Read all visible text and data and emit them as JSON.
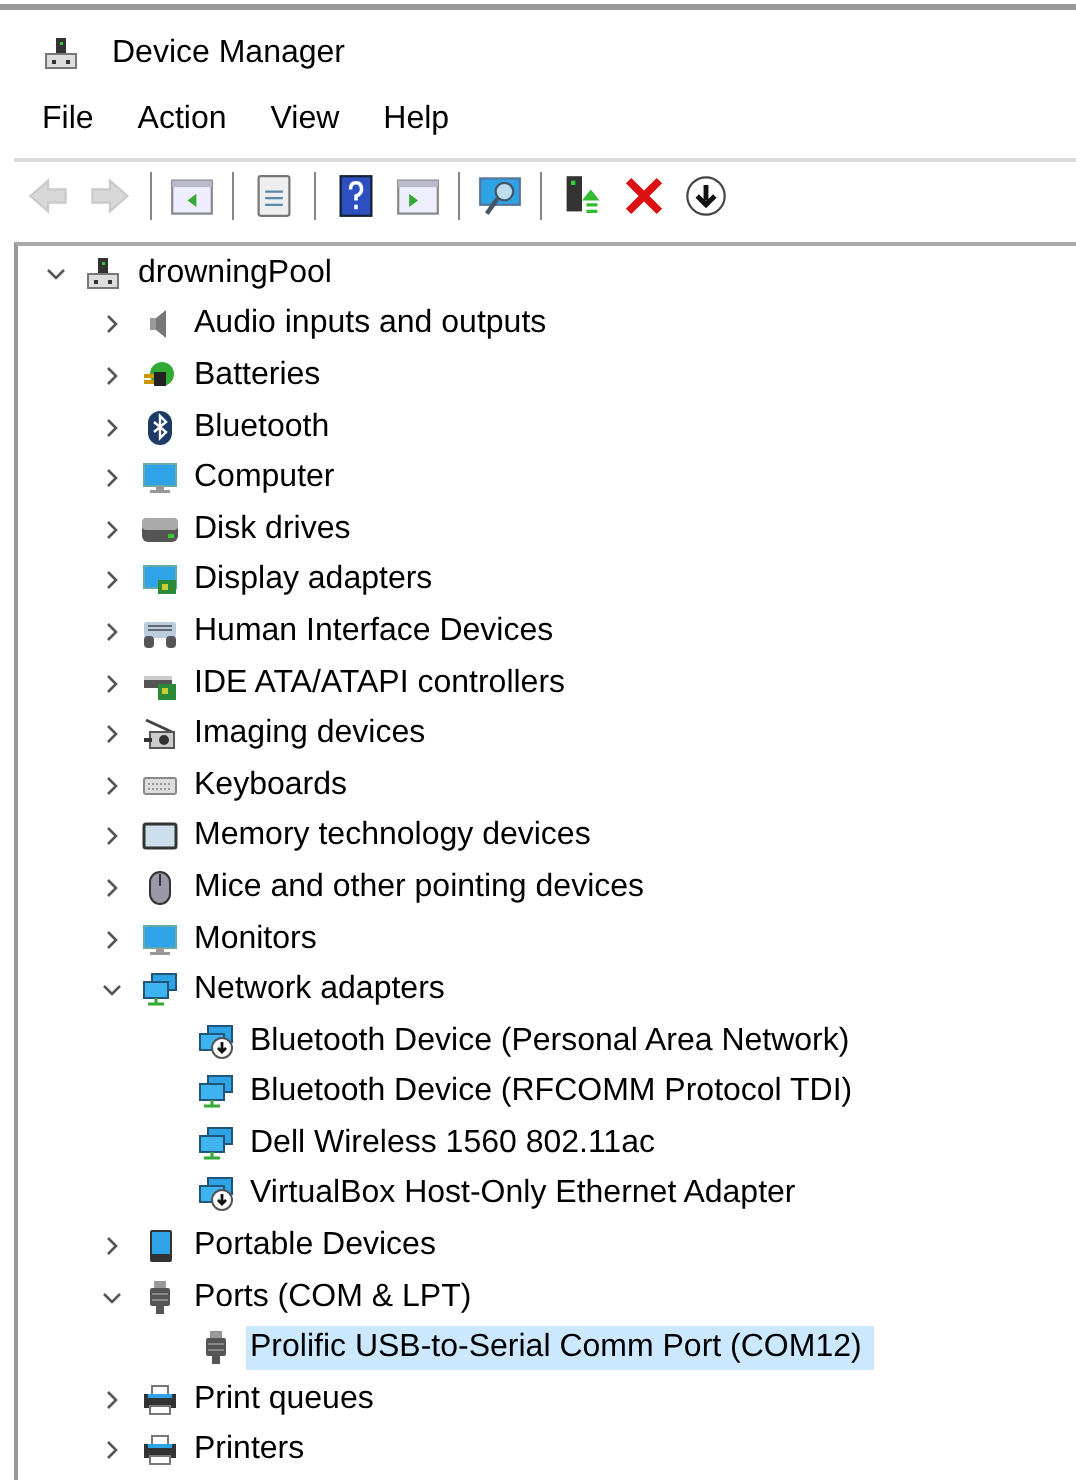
{
  "window": {
    "title": "Device Manager"
  },
  "menu": [
    "File",
    "Action",
    "View",
    "Help"
  ],
  "toolbar": [
    {
      "kind": "back",
      "disabled": true
    },
    {
      "kind": "forward",
      "disabled": true
    },
    {
      "kind": "separator"
    },
    {
      "kind": "pane",
      "disabled": false
    },
    {
      "kind": "separator"
    },
    {
      "kind": "properties",
      "disabled": false
    },
    {
      "kind": "separator"
    },
    {
      "kind": "help",
      "disabled": false
    },
    {
      "kind": "pane2",
      "disabled": false
    },
    {
      "kind": "separator"
    },
    {
      "kind": "scan",
      "disabled": false
    },
    {
      "kind": "separator"
    },
    {
      "kind": "update",
      "disabled": false
    },
    {
      "kind": "uninstall",
      "disabled": false
    },
    {
      "kind": "disable",
      "disabled": false
    }
  ],
  "tree": {
    "label": "drowningPool",
    "kind": "computer-node",
    "expanded": true,
    "selected": false,
    "children": [
      {
        "label": "Audio inputs and outputs",
        "kind": "speaker",
        "expanded": false,
        "selected": false
      },
      {
        "label": "Batteries",
        "kind": "battery",
        "expanded": false,
        "selected": false
      },
      {
        "label": "Bluetooth",
        "kind": "bluetooth",
        "expanded": false,
        "selected": false
      },
      {
        "label": "Computer",
        "kind": "monitor",
        "expanded": false,
        "selected": false
      },
      {
        "label": "Disk drives",
        "kind": "disk",
        "expanded": false,
        "selected": false
      },
      {
        "label": "Display adapters",
        "kind": "display-adapter",
        "expanded": false,
        "selected": false
      },
      {
        "label": "Human Interface Devices",
        "kind": "hid",
        "expanded": false,
        "selected": false
      },
      {
        "label": "IDE ATA/ATAPI controllers",
        "kind": "ide",
        "expanded": false,
        "selected": false
      },
      {
        "label": "Imaging devices",
        "kind": "camera",
        "expanded": false,
        "selected": false
      },
      {
        "label": "Keyboards",
        "kind": "keyboard",
        "expanded": false,
        "selected": false
      },
      {
        "label": "Memory technology devices",
        "kind": "memory",
        "expanded": false,
        "selected": false
      },
      {
        "label": "Mice and other pointing devices",
        "kind": "mouse",
        "expanded": false,
        "selected": false
      },
      {
        "label": "Monitors",
        "kind": "monitor",
        "expanded": false,
        "selected": false
      },
      {
        "label": "Network adapters",
        "kind": "network",
        "expanded": true,
        "selected": false,
        "children": [
          {
            "label": "Bluetooth Device (Personal Area Network)",
            "kind": "network-disabled",
            "selected": false
          },
          {
            "label": "Bluetooth Device (RFCOMM Protocol TDI)",
            "kind": "network",
            "selected": false
          },
          {
            "label": "Dell Wireless 1560 802.11ac",
            "kind": "network",
            "selected": false
          },
          {
            "label": "VirtualBox Host-Only Ethernet Adapter",
            "kind": "network-disabled",
            "selected": false
          }
        ]
      },
      {
        "label": "Portable Devices",
        "kind": "portable",
        "expanded": false,
        "selected": false
      },
      {
        "label": "Ports (COM & LPT)",
        "kind": "port",
        "expanded": true,
        "selected": false,
        "children": [
          {
            "label": "Prolific USB-to-Serial Comm Port (COM12)",
            "kind": "port",
            "selected": true
          }
        ]
      },
      {
        "label": "Print queues",
        "kind": "printer",
        "expanded": false,
        "selected": false
      },
      {
        "label": "Printers",
        "kind": "printer",
        "expanded": false,
        "selected": false
      }
    ]
  }
}
